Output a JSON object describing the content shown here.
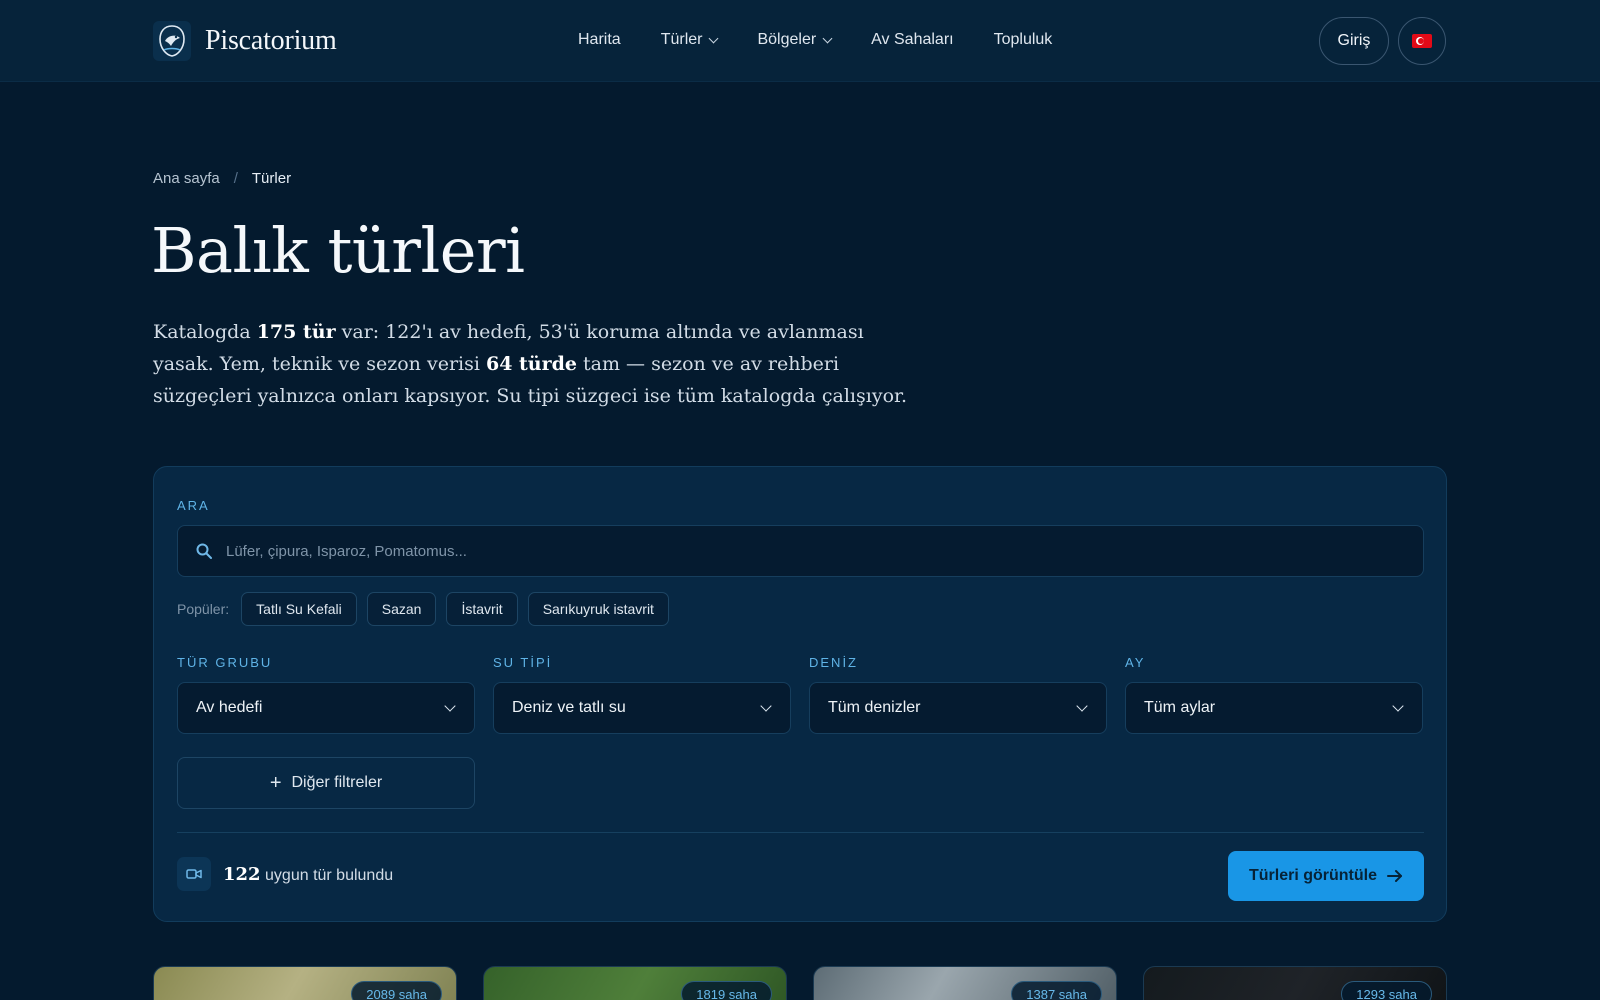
{
  "brand": {
    "name": "Piscatorium"
  },
  "nav": {
    "items": [
      {
        "label": "Harita",
        "dropdown": false
      },
      {
        "label": "Türler",
        "dropdown": true
      },
      {
        "label": "Bölgeler",
        "dropdown": true
      },
      {
        "label": "Av Sahaları",
        "dropdown": false
      },
      {
        "label": "Topluluk",
        "dropdown": false
      }
    ],
    "login_label": "Giriş",
    "language": "tr"
  },
  "breadcrumb": {
    "home": "Ana sayfa",
    "sep": "/",
    "current": "Türler"
  },
  "page": {
    "title": "Balık türleri",
    "lead_1": "Katalogda ",
    "lead_b1": "175 tür",
    "lead_2": " var: 122'ı av hedefi, 53'ü koruma altında ve avlanması yasak. Yem, teknik ve sezon verisi ",
    "lead_b2": "64 türde",
    "lead_3": " tam — sezon ve av rehberi süzgeçleri yalnızca onları kapsıyor. Su tipi süzgeci ise tüm katalogda çalışıyor."
  },
  "search": {
    "label": "ARA",
    "placeholder": "Lüfer, çipura, Isparoz, Pomatomus...",
    "popular_label": "Popüler:",
    "popular": [
      "Tatlı Su Kefali",
      "Sazan",
      "İstavrit",
      "Sarıkuyruk istavrit"
    ]
  },
  "filters": [
    {
      "label": "TÜR GRUBU",
      "value": "Av hedefi"
    },
    {
      "label": "SU TİPİ",
      "value": "Deniz ve tatlı su"
    },
    {
      "label": "DENİZ",
      "value": "Tüm denizler"
    },
    {
      "label": "AY",
      "value": "Tüm aylar"
    }
  ],
  "more_filters_label": "Diğer filtreler",
  "results": {
    "count": "122",
    "text": " uygun tür bulundu"
  },
  "cta_label": "Türleri görüntüle",
  "cards": [
    {
      "badge": "2089 saha"
    },
    {
      "badge": "1819 saha"
    },
    {
      "badge": "1387 saha"
    },
    {
      "badge": "1293 saha"
    }
  ],
  "colors": {
    "accent": "#1996e6",
    "background": "#041a2e",
    "panel": "#072844",
    "label": "#5fb3e6"
  }
}
